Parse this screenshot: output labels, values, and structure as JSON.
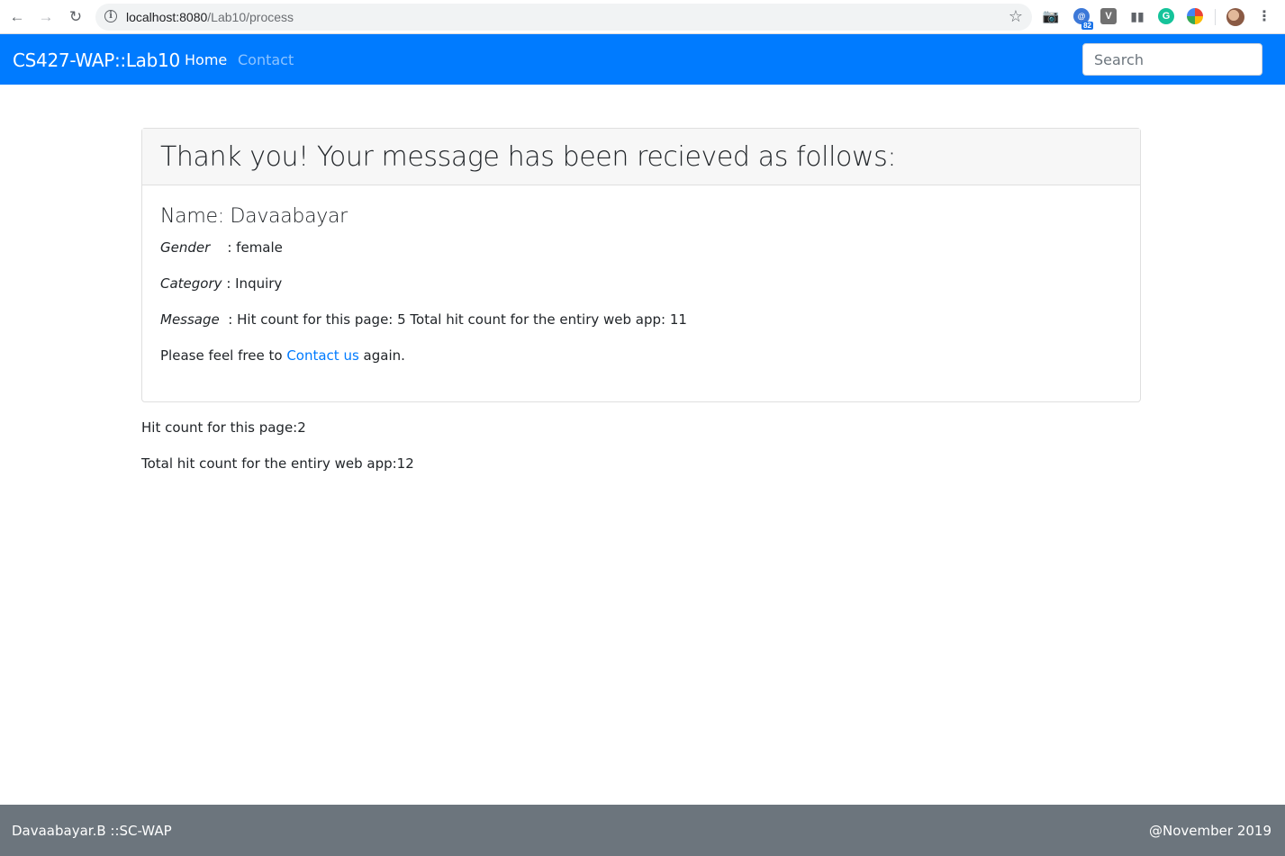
{
  "browser": {
    "url_host": "localhost:8080",
    "url_path": "/Lab10/process",
    "extensions": [
      "camera-icon",
      "grammarly-icon",
      "v-icon",
      "chart-icon",
      "g-icon",
      "color-wheel-icon",
      "avatar-icon"
    ],
    "grammar_badge": "82",
    "v_label": "V",
    "g_label": "G"
  },
  "navbar": {
    "brand": "CS427-WAP::Lab10",
    "links": [
      "Home",
      "Contact"
    ],
    "search_placeholder": "Search",
    "color": "#007bff"
  },
  "card": {
    "header": "Thank you! Your message has been recieved as follows:",
    "name_line": "Name: Davaabayar",
    "gender_label": "Gender",
    "gender_value": ": female",
    "category_label": "Category",
    "category_value": ": Inquiry",
    "message_label": "Message",
    "message_value": ": Hit count for this page: 5 Total hit count for the entiry web app: 11",
    "contact_prefix": "Please feel free to",
    "contact_link": "Contact us",
    "contact_suffix": "again."
  },
  "page_hits": "Hit count for this page:2",
  "total_hits": "Total hit count for the entiry web app:12",
  "footer": {
    "left": "Davaabayar.B ::SC-WAP",
    "right": "@November 2019",
    "color": "#6c757d"
  }
}
